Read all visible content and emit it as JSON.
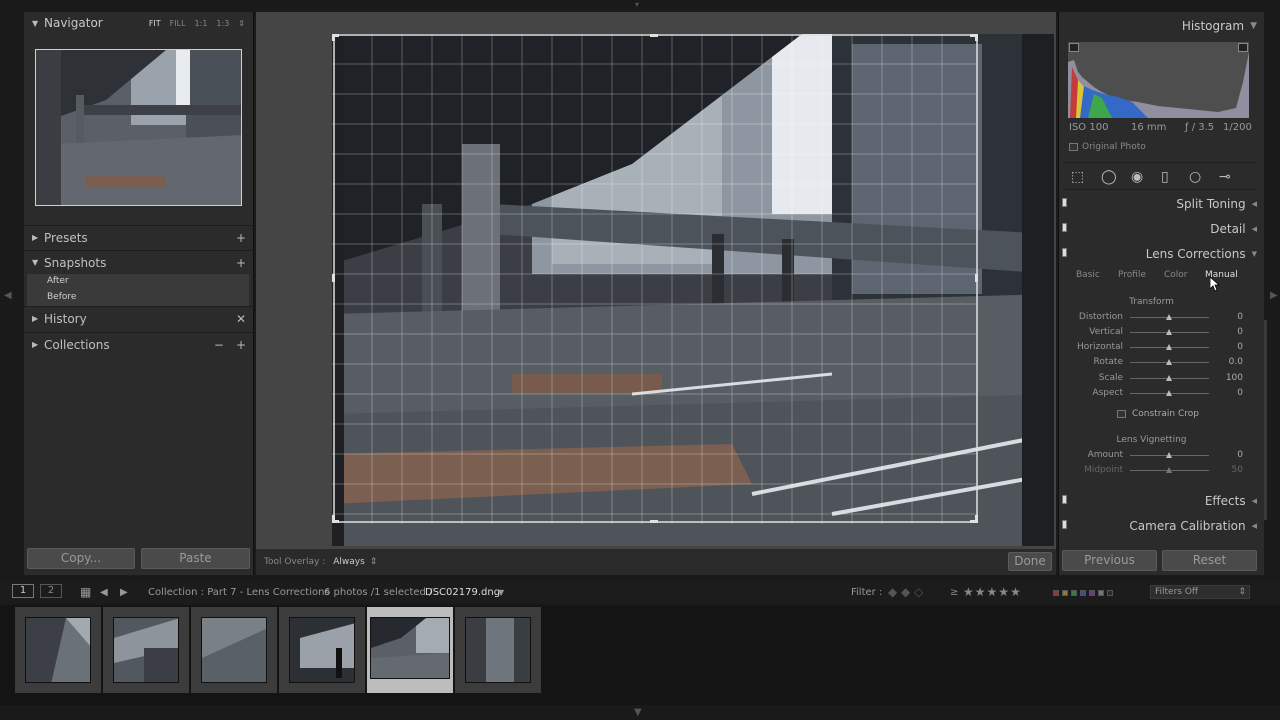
{
  "navigator": {
    "title": "Navigator",
    "options": [
      "FIT",
      "FILL",
      "1:1",
      "1:3"
    ],
    "options_arrow": "⇕"
  },
  "left_sections": {
    "presets": "Presets",
    "snapshots": "Snapshots",
    "snapshot_items": [
      "After",
      "Before"
    ],
    "history": "History",
    "collections": "Collections"
  },
  "left_buttons": {
    "copy": "Copy...",
    "paste": "Paste"
  },
  "toolbar": {
    "tool_overlay_label": "Tool Overlay :",
    "tool_overlay_value": "Always",
    "done": "Done"
  },
  "histogram": {
    "title": "Histogram",
    "iso": "ISO 100",
    "focal": "16 mm",
    "aperture": "ƒ / 3.5",
    "shutter": "1/200",
    "original_photo": "Original Photo"
  },
  "panels": {
    "split_toning": "Split Toning",
    "detail": "Detail",
    "lens_corrections": "Lens Corrections",
    "effects": "Effects",
    "camera_calibration": "Camera Calibration"
  },
  "lens_tabs": [
    "Basic",
    "Profile",
    "Color",
    "Manual"
  ],
  "transform": {
    "heading": "Transform",
    "sliders": [
      {
        "label": "Distortion",
        "value": "0"
      },
      {
        "label": "Vertical",
        "value": "0"
      },
      {
        "label": "Horizontal",
        "value": "0"
      },
      {
        "label": "Rotate",
        "value": "0.0"
      },
      {
        "label": "Scale",
        "value": "100"
      },
      {
        "label": "Aspect",
        "value": "0"
      }
    ],
    "constrain_crop": "Constrain Crop"
  },
  "vignetting": {
    "heading": "Lens Vignetting",
    "sliders": [
      {
        "label": "Amount",
        "value": "0"
      },
      {
        "label": "Midpoint",
        "value": "50"
      }
    ]
  },
  "right_buttons": {
    "previous": "Previous",
    "reset": "Reset"
  },
  "filmstrip": {
    "pages": [
      "1",
      "2"
    ],
    "collection": "Collection : Part 7 - Lens Corrections",
    "count": "6 photos /1 selected /",
    "filename": "DSC02179.dng",
    "filter_label": "Filter :",
    "filters_off": "Filters Off",
    "ge": "≥"
  },
  "colors": {
    "accent_selected": "#bdbdbd",
    "panel_bg": "#2b2b2b"
  }
}
